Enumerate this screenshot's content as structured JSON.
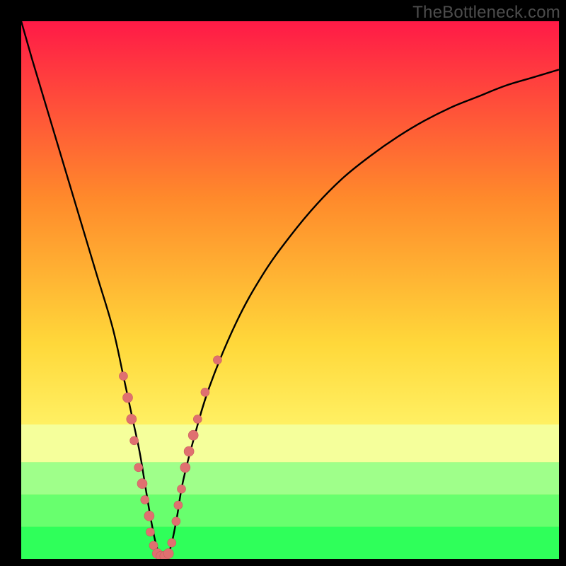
{
  "watermark": "TheBottleneck.com",
  "colors": {
    "frame": "#000000",
    "gradient_top": "#ff1a47",
    "gradient_mid1": "#ff8a2b",
    "gradient_mid2": "#ffd83a",
    "gradient_low": "#fff56b",
    "band_pale": "#f5ff9b",
    "band_green_light": "#9fff8a",
    "band_green": "#2fff5a",
    "curve": "#000000",
    "marker": "#e07070",
    "marker_stroke": "#c85e5e"
  },
  "chart_data": {
    "type": "line",
    "title": "",
    "xlabel": "",
    "ylabel": "",
    "xlim": [
      0,
      100
    ],
    "ylim": [
      0,
      100
    ],
    "series": [
      {
        "name": "bottleneck-curve",
        "x": [
          0,
          2,
          5,
          8,
          11,
          14,
          17,
          19,
          20.5,
          22,
          23,
          24,
          25,
          26,
          27,
          28,
          29,
          30,
          32,
          35,
          40,
          45,
          50,
          55,
          60,
          65,
          70,
          75,
          80,
          85,
          90,
          95,
          100
        ],
        "y": [
          100,
          93,
          83,
          73,
          63,
          53,
          43,
          34,
          27,
          20,
          14,
          8,
          3,
          0,
          0,
          3,
          8,
          14,
          22,
          32,
          44,
          53,
          60,
          66,
          71,
          75,
          78.5,
          81.5,
          84,
          86,
          88,
          89.5,
          91
        ]
      }
    ],
    "markers": [
      {
        "x": 19.0,
        "y": 34,
        "r": 6
      },
      {
        "x": 19.8,
        "y": 30,
        "r": 7
      },
      {
        "x": 20.5,
        "y": 26,
        "r": 7
      },
      {
        "x": 21.0,
        "y": 22,
        "r": 6
      },
      {
        "x": 21.8,
        "y": 17,
        "r": 6
      },
      {
        "x": 22.5,
        "y": 14,
        "r": 7
      },
      {
        "x": 23.0,
        "y": 11,
        "r": 6
      },
      {
        "x": 23.8,
        "y": 8,
        "r": 7
      },
      {
        "x": 24.0,
        "y": 5,
        "r": 6
      },
      {
        "x": 24.6,
        "y": 2.5,
        "r": 6
      },
      {
        "x": 25.3,
        "y": 1,
        "r": 7
      },
      {
        "x": 26.0,
        "y": 0.5,
        "r": 7
      },
      {
        "x": 26.7,
        "y": 0.5,
        "r": 7
      },
      {
        "x": 27.4,
        "y": 1,
        "r": 7
      },
      {
        "x": 28.0,
        "y": 3,
        "r": 6
      },
      {
        "x": 28.8,
        "y": 7,
        "r": 6
      },
      {
        "x": 29.2,
        "y": 10,
        "r": 6
      },
      {
        "x": 29.8,
        "y": 13,
        "r": 6
      },
      {
        "x": 30.5,
        "y": 17,
        "r": 7
      },
      {
        "x": 31.2,
        "y": 20,
        "r": 7
      },
      {
        "x": 32.0,
        "y": 23,
        "r": 7
      },
      {
        "x": 32.8,
        "y": 26,
        "r": 6
      },
      {
        "x": 34.2,
        "y": 31,
        "r": 6
      },
      {
        "x": 36.5,
        "y": 37,
        "r": 6
      }
    ],
    "bands": [
      {
        "name": "pale-band",
        "y0": 25,
        "y1": 18
      },
      {
        "name": "light-green",
        "y0": 18,
        "y1": 12
      },
      {
        "name": "mid-green",
        "y0": 12,
        "y1": 6
      },
      {
        "name": "green",
        "y0": 6,
        "y1": 0
      }
    ]
  }
}
